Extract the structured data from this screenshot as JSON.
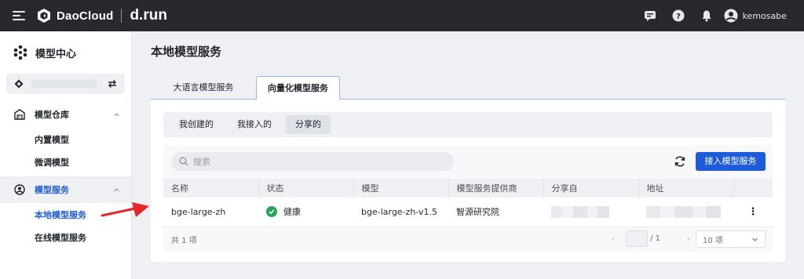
{
  "topbar": {
    "brand_name": "DaoCloud",
    "brand_run": "d.run",
    "icons": [
      "menu-icon",
      "message-icon",
      "help-icon",
      "bell-icon",
      "user-avatar-icon"
    ],
    "username": "kemosabe"
  },
  "sidebar": {
    "title": "模型中心",
    "groups": [
      {
        "label": "模型仓库",
        "icon": "warehouse-icon",
        "items": [
          "内置模型",
          "微调模型"
        ]
      },
      {
        "label": "模型服务",
        "icon": "service-icon",
        "items": [
          "本地模型服务",
          "在线模型服务"
        ]
      }
    ]
  },
  "page": {
    "title": "本地模型服务",
    "tabs": [
      "大语言模型服务",
      "向量化模型服务"
    ],
    "active_tab": "向量化模型服务",
    "subtabs": [
      "我创建的",
      "我接入的",
      "分享的"
    ],
    "active_subtab": "分享的",
    "search_placeholder": "搜索",
    "add_button": "接入模型服务",
    "columns": [
      "名称",
      "状态",
      "模型",
      "模型服务提供商",
      "分享自",
      "地址"
    ],
    "rows": [
      {
        "name": "bge-large-zh",
        "status": "健康",
        "model": "bge-large-zh-v1.5",
        "provider": "智源研究院"
      }
    ],
    "total": "共 1 项",
    "page_info": "/ 1",
    "page_size": "10 项"
  },
  "colors": {
    "accent": "#1d5bd8",
    "topbar": "#27292e",
    "healthy": "#25a45b",
    "annotation": "#e8262a"
  }
}
